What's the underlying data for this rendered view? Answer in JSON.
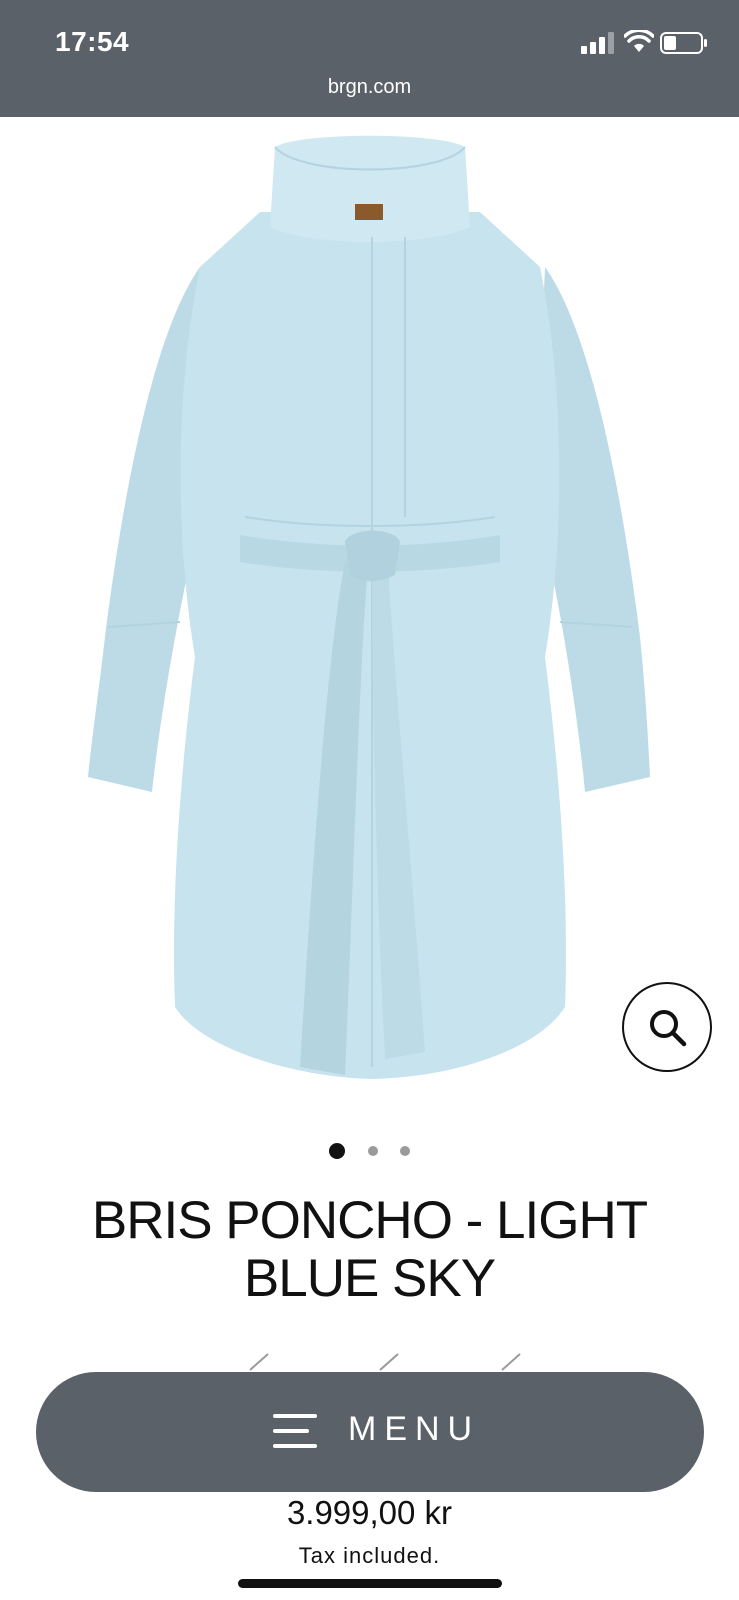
{
  "status_bar": {
    "time": "17:54"
  },
  "browser": {
    "url": "brgn.com"
  },
  "gallery": {
    "image_count": 3,
    "active_index": 0,
    "zoom_icon": "magnifier-icon"
  },
  "product": {
    "title": "BRIS PONCHO - LIGHT BLUE SKY",
    "price": "3.999,00 kr",
    "tax_note": "Tax included."
  },
  "menu": {
    "label": "MENU",
    "icon": "hamburger-icon"
  },
  "colors": {
    "bar": "#5b6168",
    "coat": "#c7e3ee",
    "text": "#111111"
  }
}
